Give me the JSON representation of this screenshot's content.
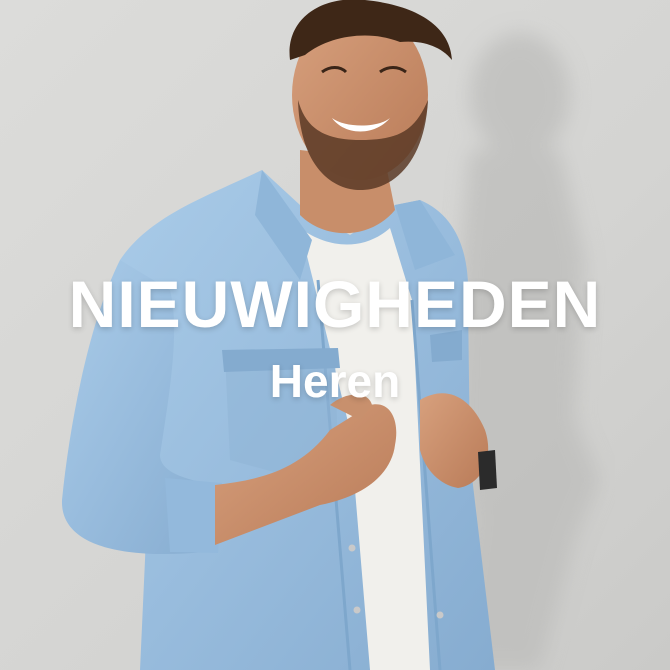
{
  "banner": {
    "headline": "NIEUWIGHEDEN",
    "subline": "Heren",
    "text_color": "#ffffff",
    "shirt_color": "#9cc0e0",
    "background_color": "#d9d9d7"
  }
}
